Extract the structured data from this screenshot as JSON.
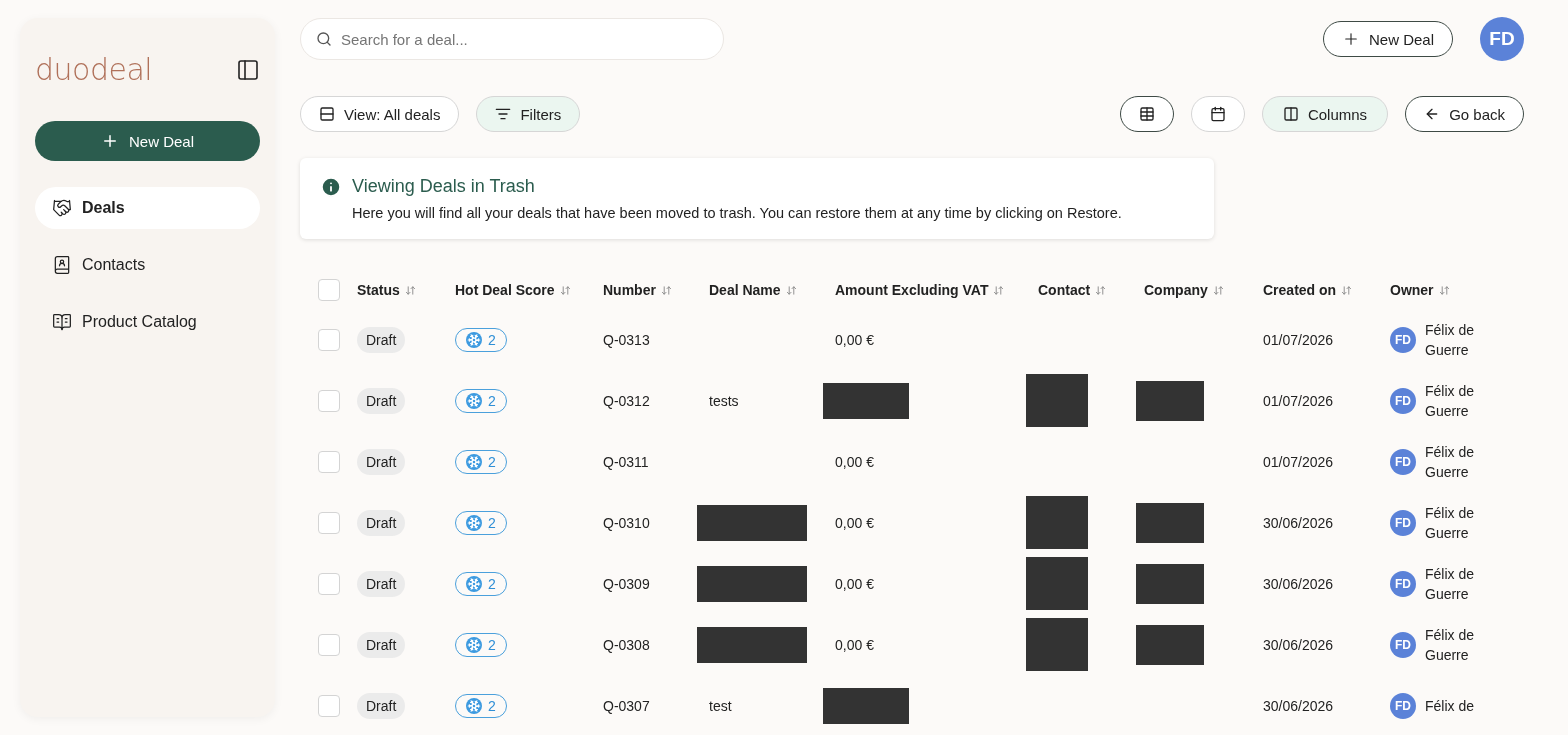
{
  "sidebar": {
    "logo": "duodeal",
    "new_deal": "New Deal",
    "items": [
      {
        "label": "Deals",
        "kind": "deals",
        "selected": true
      },
      {
        "label": "Contacts",
        "kind": "contacts",
        "selected": false
      },
      {
        "label": "Product Catalog",
        "kind": "catalog",
        "selected": false
      }
    ]
  },
  "search": {
    "placeholder": "Search for a deal..."
  },
  "header": {
    "new_deal": "New Deal",
    "avatar": "FD"
  },
  "toolbar": {
    "view": "View: All deals",
    "filters": "Filters",
    "columns": "Columns",
    "go_back": "Go back"
  },
  "notice": {
    "title": "Viewing Deals in Trash",
    "text": "Here you will find all your deals that have been moved to trash. You can restore them at any time by clicking on Restore."
  },
  "table": {
    "select_all_checked": false,
    "columns": [
      "Status",
      "Hot Deal Score",
      "Number",
      "Deal Name",
      "Amount Excluding VAT",
      "Contact",
      "Company",
      "Created on",
      "Owner"
    ],
    "rows": [
      {
        "checked": false,
        "status": "Draft",
        "score": "2",
        "number": "Q-0313",
        "amount": "0,00 €",
        "created": "01/07/2026",
        "owner_initials": "FD",
        "owner": "Félix de Guerre"
      },
      {
        "checked": false,
        "status": "Draft",
        "score": "2",
        "number": "Q-0312",
        "deal_name": "tests",
        "amount_redacted": true,
        "contact_redacted": true,
        "company_redacted": true,
        "created": "01/07/2026",
        "owner_initials": "FD",
        "owner": "Félix de Guerre"
      },
      {
        "checked": false,
        "status": "Draft",
        "score": "2",
        "number": "Q-0311",
        "amount": "0,00 €",
        "created": "01/07/2026",
        "owner_initials": "FD",
        "owner": "Félix de Guerre"
      },
      {
        "checked": false,
        "status": "Draft",
        "score": "2",
        "number": "Q-0310",
        "deal_name_redacted": true,
        "amount": "0,00 €",
        "contact_redacted": true,
        "company_redacted": true,
        "created": "30/06/2026",
        "owner_initials": "FD",
        "owner": "Félix de Guerre"
      },
      {
        "checked": false,
        "status": "Draft",
        "score": "2",
        "number": "Q-0309",
        "deal_name_redacted": true,
        "amount": "0,00 €",
        "contact_redacted": true,
        "company_redacted": true,
        "created": "30/06/2026",
        "owner_initials": "FD",
        "owner": "Félix de Guerre"
      },
      {
        "checked": false,
        "status": "Draft",
        "score": "2",
        "number": "Q-0308",
        "deal_name_redacted": true,
        "amount": "0,00 €",
        "contact_redacted": true,
        "company_redacted": true,
        "created": "30/06/2026",
        "owner_initials": "FD",
        "owner": "Félix de Guerre"
      },
      {
        "checked": false,
        "status": "Draft",
        "score": "2",
        "number": "Q-0307",
        "deal_name": "test",
        "amount_redacted": true,
        "created": "30/06/2026",
        "owner_initials": "FD",
        "owner": "Félix de"
      }
    ]
  }
}
